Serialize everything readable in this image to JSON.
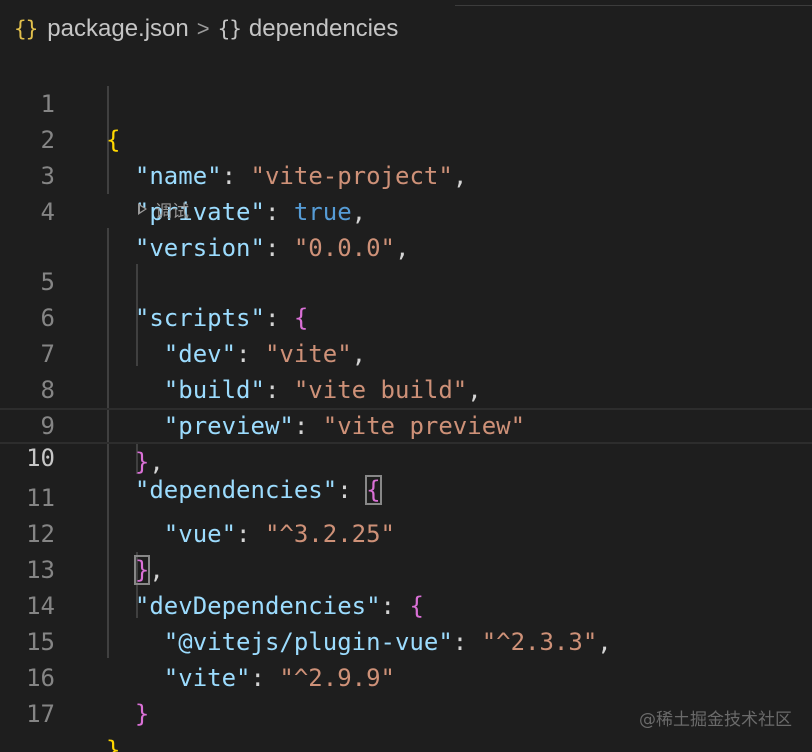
{
  "breadcrumb": {
    "file_icon": "json-braces-icon",
    "file_icon_glyph": "{}",
    "file": "package.json",
    "separator": ">",
    "symbol_icon_glyph": "{}",
    "symbol": "dependencies"
  },
  "codelens": {
    "label": "调试",
    "icon": "play-icon"
  },
  "current_line": 10,
  "lines": [
    {
      "num": "1"
    },
    {
      "num": "2"
    },
    {
      "num": "3"
    },
    {
      "num": "4"
    },
    {
      "num": "5"
    },
    {
      "num": "6"
    },
    {
      "num": "7"
    },
    {
      "num": "8"
    },
    {
      "num": "9"
    },
    {
      "num": "10"
    },
    {
      "num": "11"
    },
    {
      "num": "12"
    },
    {
      "num": "13"
    },
    {
      "num": "14"
    },
    {
      "num": "15"
    },
    {
      "num": "16"
    },
    {
      "num": "17"
    }
  ],
  "code": {
    "l1": {
      "open": "{"
    },
    "l2": {
      "key": "\"name\"",
      "colon": ": ",
      "value": "\"vite-project\"",
      "comma": ","
    },
    "l3": {
      "key": "\"private\"",
      "colon": ": ",
      "value": "true",
      "comma": ","
    },
    "l4": {
      "key": "\"version\"",
      "colon": ": ",
      "value": "\"0.0.0\"",
      "comma": ","
    },
    "l5": {
      "key": "\"scripts\"",
      "colon": ": ",
      "open": "{"
    },
    "l6": {
      "key": "\"dev\"",
      "colon": ": ",
      "value": "\"vite\"",
      "comma": ","
    },
    "l7": {
      "key": "\"build\"",
      "colon": ": ",
      "value": "\"vite build\"",
      "comma": ","
    },
    "l8": {
      "key": "\"preview\"",
      "colon": ": ",
      "value": "\"vite preview\""
    },
    "l9": {
      "close": "}",
      "comma": ","
    },
    "l10": {
      "key": "\"dependencies\"",
      "colon": ": ",
      "open": "{"
    },
    "l11": {
      "key": "\"vue\"",
      "colon": ": ",
      "value": "\"^3.2.25\""
    },
    "l12": {
      "close": "}",
      "comma": ","
    },
    "l13": {
      "key": "\"devDependencies\"",
      "colon": ": ",
      "open": "{"
    },
    "l14": {
      "key": "\"@vitejs/plugin-vue\"",
      "colon": ": ",
      "value": "\"^2.3.3\"",
      "comma": ","
    },
    "l15": {
      "key": "\"vite\"",
      "colon": ": ",
      "value": "\"^2.9.9\""
    },
    "l16": {
      "close": "}"
    },
    "l17": {
      "close": "}"
    }
  },
  "watermark": "@稀土掘金技术社区",
  "colors": {
    "background": "#1e1e1e",
    "key": "#9cdcfe",
    "string": "#ce9178",
    "boolean": "#569cd6",
    "bracket_level1": "#ffd700",
    "bracket_level2": "#da70d6"
  }
}
